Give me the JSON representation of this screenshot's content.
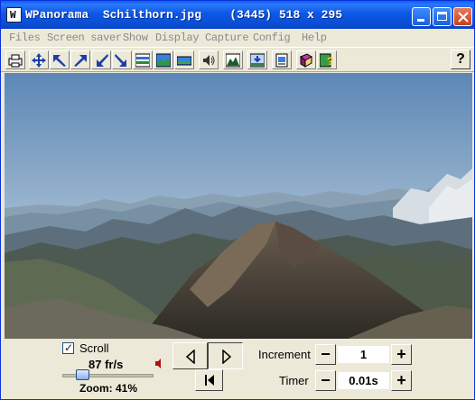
{
  "window": {
    "title": "WPanorama  Schilthorn.jpg    (3445) 518 x 295",
    "icon_letter": "W"
  },
  "menu": [
    "Files",
    "Screen saver",
    "Show",
    "Display",
    "Capture",
    "Config",
    "Help"
  ],
  "toolbar": {
    "buttons": [
      "print-icon",
      "move-icon",
      "shrink-left-icon",
      "expand-right-icon",
      "shrink-down-icon",
      "expand-down-icon",
      "panorama-strip-icon",
      "panorama-color-icon",
      "panorama-flat-icon",
      "sound-icon",
      "landscape-icon",
      "horizon-icon",
      "document-icon",
      "book-icon",
      "image-help-icon"
    ],
    "help_label": "?"
  },
  "controls": {
    "scroll_label": "Scroll",
    "scroll_checked": true,
    "fps": "87 fr/s",
    "zoom": "Zoom: 41%",
    "zoom_value": 0.41,
    "increment_label": "Increment",
    "increment_value": "1",
    "timer_label": "Timer",
    "timer_value": "0.01s",
    "minus": "−",
    "plus": "+"
  }
}
